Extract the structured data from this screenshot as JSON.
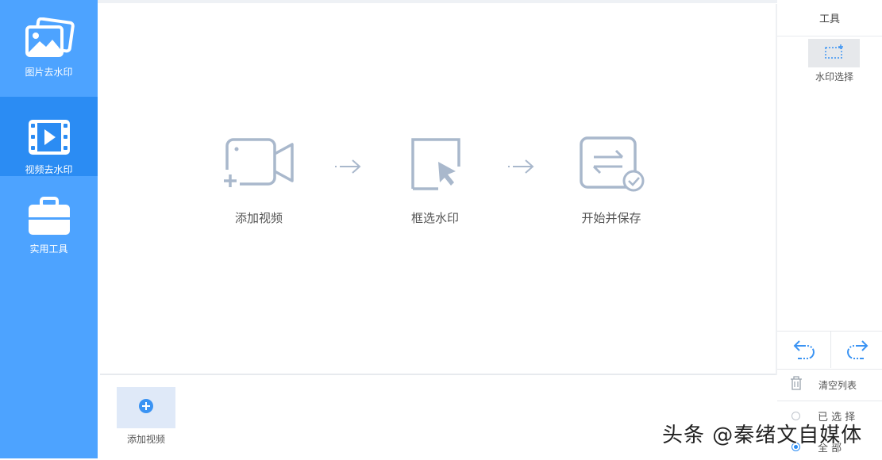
{
  "sidebar": {
    "items": [
      {
        "label": "图片去水印",
        "icon": "image-icon"
      },
      {
        "label": "视频去水印",
        "icon": "video-icon",
        "active": true
      },
      {
        "label": "实用工具",
        "icon": "toolbox-icon"
      }
    ]
  },
  "steps": [
    {
      "label": "添加视频",
      "icon": "add-video-icon"
    },
    {
      "label": "框选水印",
      "icon": "select-area-icon"
    },
    {
      "label": "开始并保存",
      "icon": "save-icon"
    }
  ],
  "bottom": {
    "add_label": "添加视频"
  },
  "right_panel": {
    "title": "工具",
    "watermark_select_label": "水印选择",
    "clear_list_label": "清空列表",
    "options": [
      {
        "label": "已 选 择",
        "selected": false
      },
      {
        "label": "全 部",
        "selected": true
      }
    ]
  },
  "overlay_watermark": "头条 @秦绪文自媒体",
  "colors": {
    "sidebar": "#4da3ff",
    "sidebar_active": "#2b8cf3",
    "icon_gray": "#a9b8cc"
  }
}
